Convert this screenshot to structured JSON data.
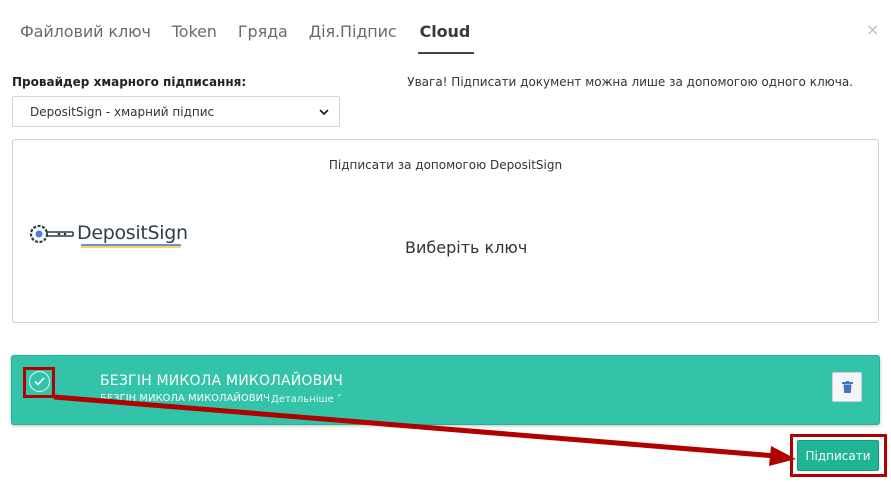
{
  "tabs": [
    {
      "label": "Файловий ключ",
      "active": false
    },
    {
      "label": "Token",
      "active": false
    },
    {
      "label": "Гряда",
      "active": false
    },
    {
      "label": "Дія.Підпис",
      "active": false
    },
    {
      "label": "Cloud",
      "active": true
    }
  ],
  "close_label": "×",
  "provider": {
    "label": "Провайдер хмарного підписання:",
    "selected": "DepositSign - хмарний підпис"
  },
  "warning": "Увага! Підписати документ можна лише за допомогою одного ключа.",
  "sign_box": {
    "title": "Підписати за допомогою DepositSign",
    "logo_text": "DepositSign",
    "choose_key": "Виберіть ключ"
  },
  "key": {
    "name": "БЕЗГІН МИКОЛА МИКОЛАЙОВИЧ",
    "subtitle": "БЕЗГІН МИКОЛА МИКОЛАЙОВИЧ",
    "details": "Детальніше ˅"
  },
  "sign_button": "Підписати",
  "colors": {
    "accent": "#33c3a8",
    "button": "#1fb493",
    "annotation": "#b00000"
  },
  "icons": {
    "select": "chevron-down-icon",
    "check": "check-circle-icon",
    "delete": "trash-icon",
    "close": "close-icon"
  }
}
